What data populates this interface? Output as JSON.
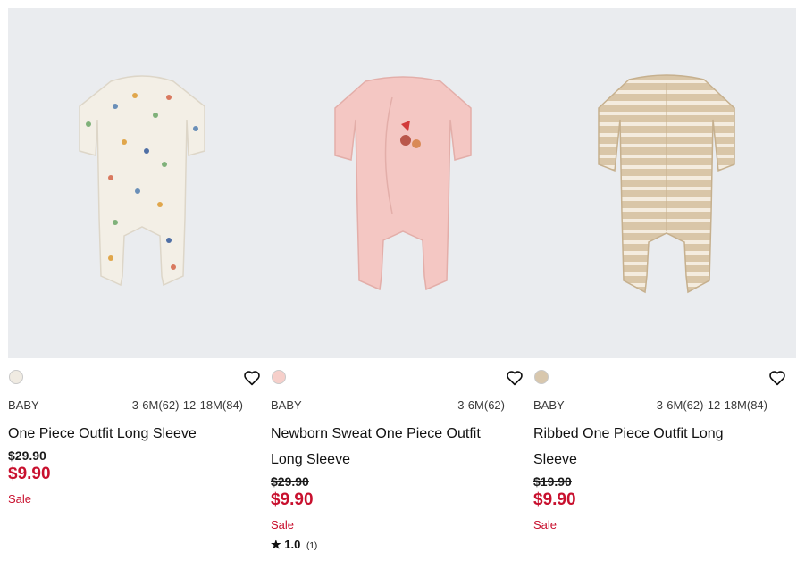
{
  "products": [
    {
      "gender": "BABY",
      "sizes": "3-6M(62)-12-18M(84)",
      "name_line1": "One Piece Outfit Long Sleeve",
      "name_line2": "",
      "original_price": "$29.90",
      "sale_price": "$9.90",
      "sale_label": "Sale",
      "swatch_color": "#f0ebe2",
      "garment_color": "#f3efe6"
    },
    {
      "gender": "BABY",
      "sizes": "3-6M(62)",
      "name_line1": "Newborn Sweat One Piece Outfit",
      "name_line2": "Long Sleeve",
      "original_price": "$29.90",
      "sale_price": "$9.90",
      "sale_label": "Sale",
      "rating_value": "1.0",
      "rating_count": "(1)",
      "swatch_color": "#f6cfca",
      "garment_color": "#f4c7c3"
    },
    {
      "gender": "BABY",
      "sizes": "3-6M(62)-12-18M(84)",
      "name_line1": "Ribbed One Piece Outfit Long",
      "name_line2": "Sleeve",
      "original_price": "$19.90",
      "sale_price": "$9.90",
      "sale_label": "Sale",
      "swatch_color": "#d8c7ad",
      "garment_color": "#d9c6a8"
    }
  ],
  "icons": {
    "favorite": "heart-outline-icon",
    "rating": "star-icon"
  },
  "colors": {
    "sale_red": "#c8102e",
    "image_background": "#eaecef"
  }
}
